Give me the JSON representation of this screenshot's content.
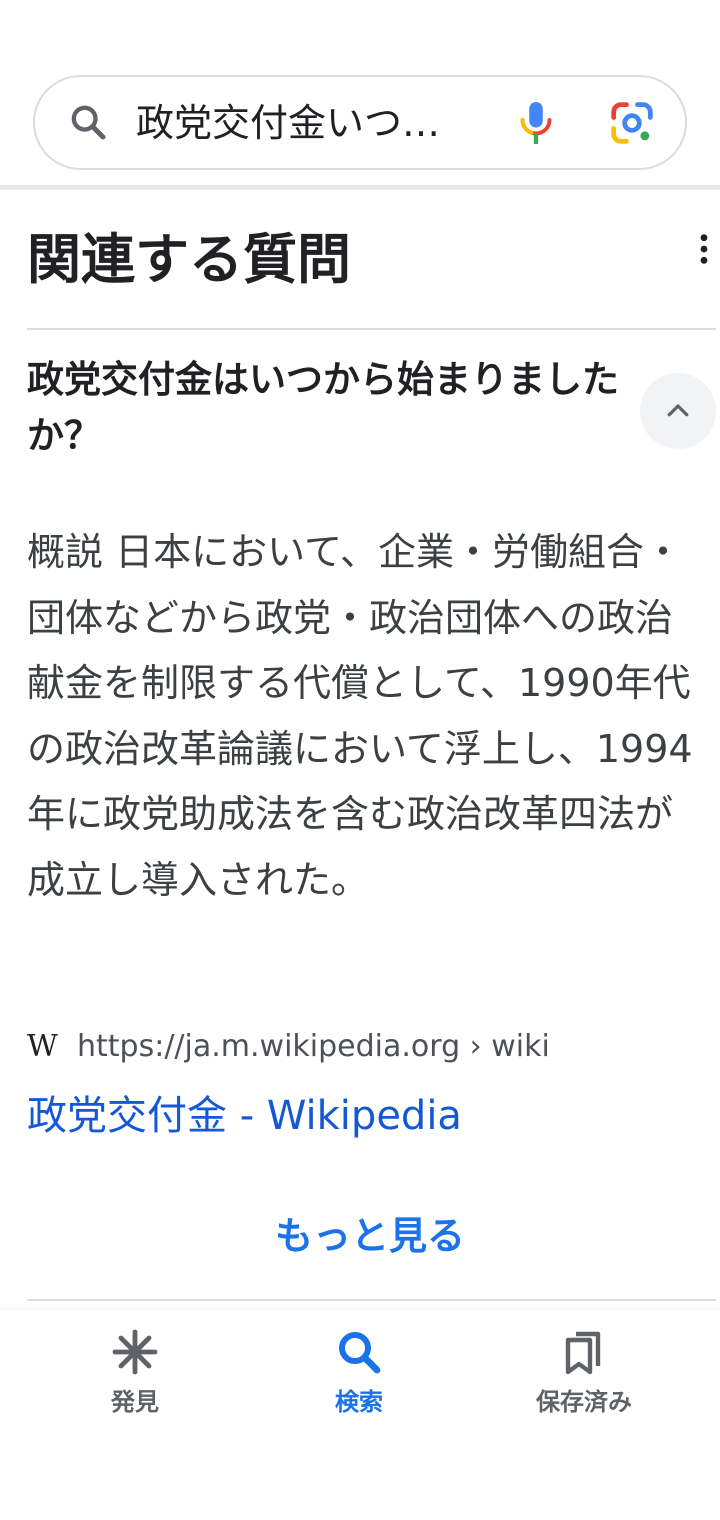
{
  "search": {
    "query": "政党交付金いつ…"
  },
  "section": {
    "title": "関連する質問"
  },
  "qa": {
    "question": "政党交付金はいつから始まりましたか？",
    "answer": "概説 日本において、企業・労働組合・団体などから政党・政治団体への政治献金を制限する代償として、1990年代の政治改革論議において浮上し、1994年に政党助成法を含む政治改革四法が成立し導入された。",
    "source_icon_text": "W",
    "source_url": "https://ja.m.wikipedia.org › wiki",
    "result_title": "政党交付金 - Wikipedia"
  },
  "more_label": "もっと見る",
  "nav": {
    "discover": "発見",
    "search": "検索",
    "saved": "保存済み"
  },
  "colors": {
    "accent": "#1a73e8",
    "link": "#1558d6",
    "text": "#202124",
    "muted": "#5f6368"
  }
}
